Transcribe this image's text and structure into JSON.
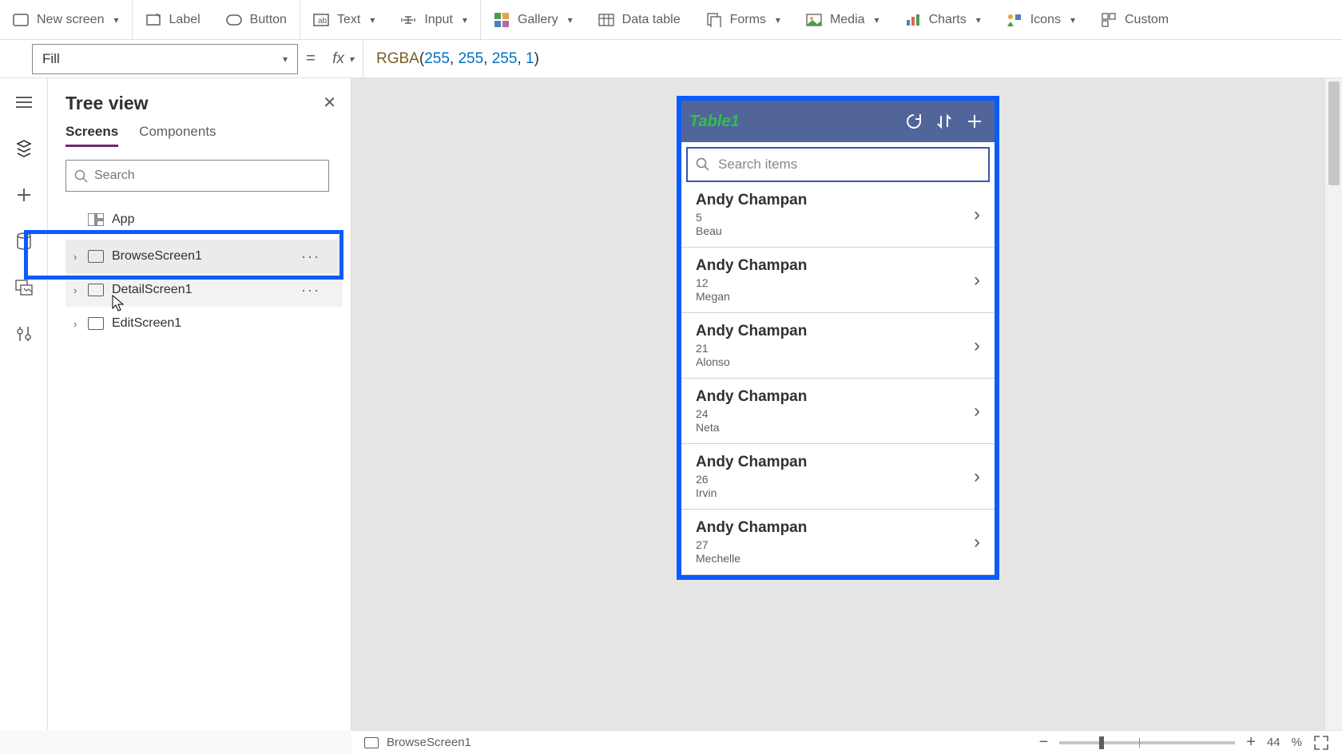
{
  "ribbon": {
    "new_screen": "New screen",
    "label": "Label",
    "button": "Button",
    "text": "Text",
    "input": "Input",
    "gallery": "Gallery",
    "data_table": "Data table",
    "forms": "Forms",
    "media": "Media",
    "charts": "Charts",
    "icons": "Icons",
    "custom": "Custom"
  },
  "formula": {
    "property": "Fill",
    "fn": "RGBA",
    "args": [
      "255",
      "255",
      "255",
      "1"
    ]
  },
  "treeview": {
    "title": "Tree view",
    "tabs": {
      "screens": "Screens",
      "components": "Components"
    },
    "search_placeholder": "Search",
    "app_label": "App",
    "nodes": [
      {
        "label": "BrowseScreen1",
        "selected": true
      },
      {
        "label": "DetailScreen1",
        "selected": false,
        "hovered": true
      },
      {
        "label": "EditScreen1",
        "selected": false
      }
    ]
  },
  "phone": {
    "title": "Table1",
    "search_placeholder": "Search items",
    "items": [
      {
        "title": "Andy Champan",
        "sub1": "5",
        "sub2": "Beau"
      },
      {
        "title": "Andy Champan",
        "sub1": "12",
        "sub2": "Megan"
      },
      {
        "title": "Andy Champan",
        "sub1": "21",
        "sub2": "Alonso"
      },
      {
        "title": "Andy Champan",
        "sub1": "24",
        "sub2": "Neta"
      },
      {
        "title": "Andy Champan",
        "sub1": "26",
        "sub2": "Irvin"
      },
      {
        "title": "Andy Champan",
        "sub1": "27",
        "sub2": "Mechelle"
      }
    ]
  },
  "statusbar": {
    "selection": "BrowseScreen1",
    "zoom": "44",
    "pct": "%"
  }
}
